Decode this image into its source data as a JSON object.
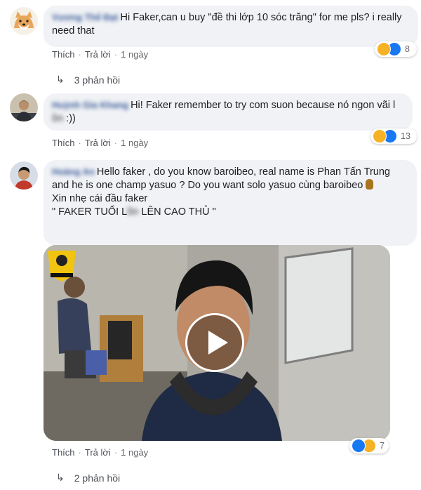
{
  "comments": [
    {
      "author": "Vương Thế Đạt",
      "text": "Hi Faker,can u buy \"đề thi lớp 10 sóc trăng\" for me pls? i really need that",
      "actions": {
        "like": "Thích",
        "reply": "Trả lời",
        "time": "1 ngày"
      },
      "reactions": {
        "icons": [
          "haha-icon",
          "like-icon"
        ],
        "count": "8"
      },
      "replies": "3 phản hồi"
    },
    {
      "author": "Huỳnh Gia Khang",
      "text_before": "Hi! Faker remember to try com suon because nó ngon vãi l",
      "text_hidden": "ồn",
      "text_after": " :))",
      "actions": {
        "like": "Thích",
        "reply": "Trả lời",
        "time": "1 ngày"
      },
      "reactions": {
        "icons": [
          "haha-icon",
          "like-icon"
        ],
        "count": "13"
      }
    },
    {
      "author": "Hoàng An",
      "text_1": "Hello faker , do you know baroibeo, real name is Phan Tấn Trung and he is one champ yasuo ? Do you want solo yasuo cùng baroibeo",
      "text_2": "Xin nhẹ cái đầu faker",
      "text_3_before": "\" FAKER TUỔI L",
      "text_3_hidden": "ồn",
      "text_3_after": " LÊN CAO THỦ \"",
      "video": {
        "channel_logo": "video-channel-logo",
        "play": "play-icon"
      },
      "actions": {
        "like": "Thích",
        "reply": "Trả lời",
        "time": "1 ngày"
      },
      "reactions": {
        "icons": [
          "like-icon",
          "haha-icon"
        ],
        "count": "7"
      },
      "replies": "2 phản hồi"
    }
  ],
  "colors": {
    "bubble": "#f0f2f5",
    "link": "#385898",
    "like": "#1877f2",
    "haha": "#f7b125"
  }
}
